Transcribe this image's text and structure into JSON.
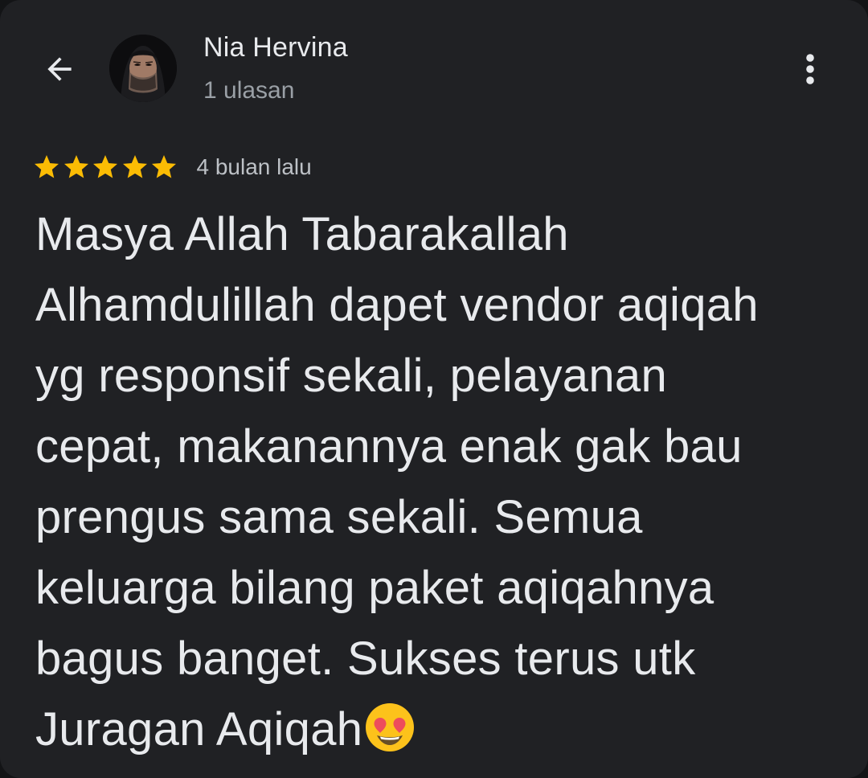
{
  "header": {
    "back_icon": "arrow-left-icon",
    "reviewer_name": "Nia Hervina",
    "review_count": "1 ulasan",
    "more_icon": "more-vert-icon"
  },
  "rating": {
    "stars": 5,
    "max_stars": 5,
    "star_color": "#fbbc04",
    "time_ago": "4 bulan lalu"
  },
  "review": {
    "lines": [
      "Masya Allah Tabarakallah",
      "Alhamdulillah dapet vendor aqiqah",
      "yg responsif sekali, pelayanan",
      "cepat, makanannya enak gak bau",
      "prengus sama sekali. Semua",
      "keluarga bilang paket aqiqahnya",
      "bagus banget. Sukses terus utk",
      "Juragan Aqiqah"
    ],
    "trailing_emoji": "heart-eyes-emoji"
  },
  "colors": {
    "background": "#202124",
    "primary_text": "#e8eaed",
    "secondary_text": "#9aa0a6"
  }
}
